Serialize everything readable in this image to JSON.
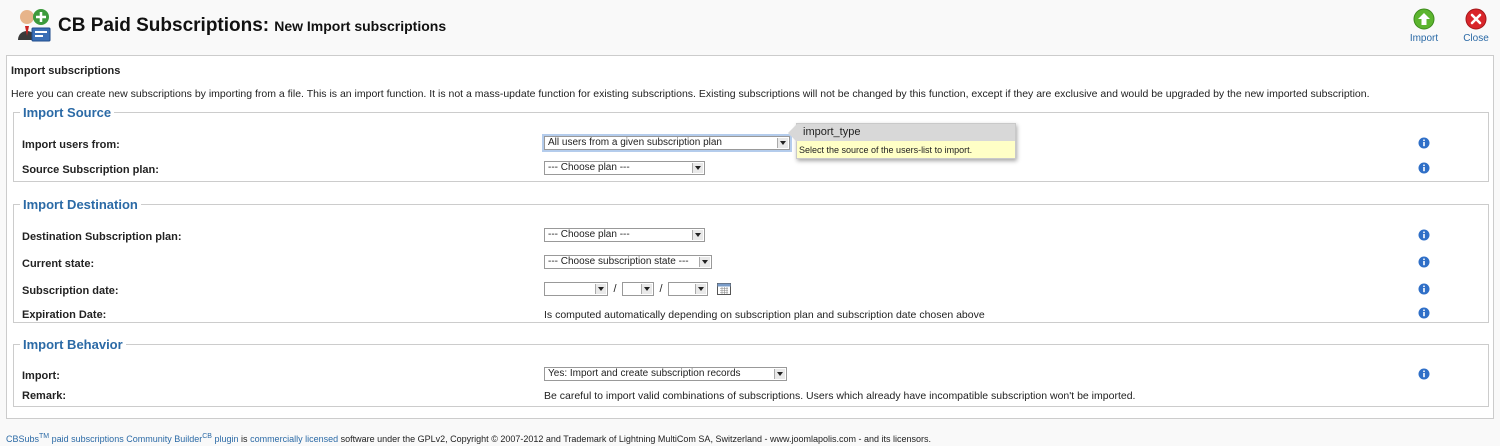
{
  "header": {
    "title": "CB Paid Subscriptions:",
    "subtitle": "New Import subscriptions",
    "import_label": "Import",
    "close_label": "Close"
  },
  "panel": {
    "title": "Import subscriptions",
    "intro": "Here you can create new subscriptions by importing from a file. This is an import function. It is not a mass-update function for existing subscriptions. Existing subscriptions will not be changed by this function, except if they are exclusive and would be upgraded by the new imported subscription."
  },
  "source": {
    "legend": "Import Source",
    "users_label": "Import users from:",
    "users_value": "All users from a given subscription plan",
    "plan_label": "Source Subscription plan:",
    "plan_value": "--- Choose plan ---"
  },
  "tooltip": {
    "title": "import_type",
    "text": "Select the source of the users-list to import."
  },
  "destination": {
    "legend": "Import Destination",
    "plan_label": "Destination Subscription plan:",
    "plan_value": "--- Choose plan ---",
    "state_label": "Current state:",
    "state_value": "--- Choose subscription state ---",
    "date_label": "Subscription date:",
    "date_sep": "/",
    "expiration_label": "Expiration Date:",
    "expiration_text": "Is computed automatically depending on subscription plan and subscription date chosen above"
  },
  "behavior": {
    "legend": "Import Behavior",
    "import_label": "Import:",
    "import_value": "Yes: Import and create subscription records",
    "remark_label": "Remark:",
    "remark_text": "Be careful to import valid combinations of subscriptions. Users which already have incompatible subscription won't be imported."
  },
  "footer": {
    "cbsubs": "CBSubs",
    "tm": "TM",
    "paid_subs": "paid subscriptions",
    "community_builder": "Community Builder",
    "cb_sup": "CB",
    "plugin": "plugin",
    "is": "is",
    "commercially_licensed": "commercially licensed",
    "rest": "software under the GPLv2, Copyright © 2007-2012 and Trademark of Lightning MultiCom SA, Switzerland - www.joomlapolis.com - and its licensors."
  },
  "colors": {
    "accent": "#2b6aa6",
    "import_green": "#5cb52e",
    "close_red": "#d9262b",
    "info_blue": "#2f6fc7",
    "tooltip_bg": "#ffffc6"
  }
}
